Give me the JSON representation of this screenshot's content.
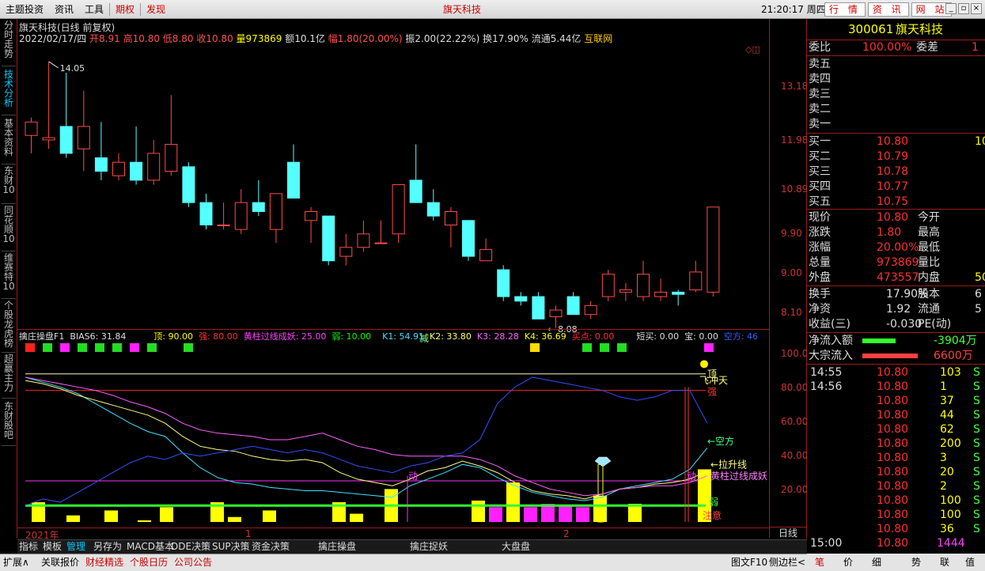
{
  "menu": {
    "items": [
      "主题投资",
      "资讯",
      "工具"
    ],
    "red_items": [
      "期权",
      "发现"
    ],
    "title": "旗天科技",
    "clock": "21:20:17 周四",
    "nav": [
      "行 情",
      "资 讯",
      "网 站"
    ]
  },
  "left_tabs": [
    "分时走势",
    "技术分析",
    "基本资料",
    "东财10",
    "同花顺10",
    "维赛特10",
    "个股龙虎榜",
    "超赢主力",
    "东财股吧"
  ],
  "header": {
    "line1": "旗天科技(日线 前复权)",
    "date": "2022/02/17/四",
    "open": "开8.91",
    "high": "高10.80",
    "low": "低8.80",
    "close": "收10.80",
    "vol": "量973869",
    "amt": "额10.1亿",
    "chg": "幅1.80(20.00%)",
    "amp": "振2.00(22.22%)",
    "turn": "换17.90%",
    "float": "流通5.44亿",
    "concept": "互联网"
  },
  "price_axis": [
    "13.18",
    "11.98",
    "10.89",
    "9.90",
    "9.00",
    "8.10"
  ],
  "price_annotations": {
    "high": "14.05",
    "low": "8.08",
    "mark": "减"
  },
  "chart_data": {
    "type": "candlestick",
    "ylim": [
      7.9,
      14.4
    ],
    "candles": [
      {
        "o": 12.4,
        "h": 12.8,
        "l": 12.0,
        "c": 12.7
      },
      {
        "o": 12.3,
        "h": 14.05,
        "l": 12.1,
        "c": 12.35
      },
      {
        "o": 12.6,
        "h": 13.8,
        "l": 11.9,
        "c": 12.0
      },
      {
        "o": 12.1,
        "h": 13.4,
        "l": 11.6,
        "c": 12.6
      },
      {
        "o": 11.9,
        "h": 12.7,
        "l": 11.4,
        "c": 11.6
      },
      {
        "o": 11.5,
        "h": 12.0,
        "l": 11.4,
        "c": 11.8
      },
      {
        "o": 11.8,
        "h": 12.6,
        "l": 11.3,
        "c": 11.4
      },
      {
        "o": 11.4,
        "h": 12.3,
        "l": 11.3,
        "c": 12.0
      },
      {
        "o": 11.6,
        "h": 13.3,
        "l": 11.5,
        "c": 12.2
      },
      {
        "o": 11.7,
        "h": 11.8,
        "l": 10.8,
        "c": 10.9
      },
      {
        "o": 10.9,
        "h": 11.1,
        "l": 10.3,
        "c": 10.4
      },
      {
        "o": 10.4,
        "h": 10.9,
        "l": 10.3,
        "c": 10.4
      },
      {
        "o": 10.3,
        "h": 11.2,
        "l": 10.2,
        "c": 10.9
      },
      {
        "o": 10.9,
        "h": 11.4,
        "l": 10.6,
        "c": 10.7
      },
      {
        "o": 10.3,
        "h": 11.1,
        "l": 10.0,
        "c": 11.1
      },
      {
        "o": 11.8,
        "h": 12.2,
        "l": 11.0,
        "c": 11.0
      },
      {
        "o": 10.5,
        "h": 10.8,
        "l": 10.0,
        "c": 10.7
      },
      {
        "o": 10.6,
        "h": 10.6,
        "l": 9.5,
        "c": 9.6
      },
      {
        "o": 9.7,
        "h": 10.2,
        "l": 9.5,
        "c": 9.9
      },
      {
        "o": 9.9,
        "h": 10.5,
        "l": 9.8,
        "c": 10.2
      },
      {
        "o": 10.0,
        "h": 10.5,
        "l": 10.0,
        "c": 10.0
      },
      {
        "o": 10.2,
        "h": 11.3,
        "l": 10.0,
        "c": 11.3
      },
      {
        "o": 11.4,
        "h": 12.2,
        "l": 10.9,
        "c": 10.9
      },
      {
        "o": 10.9,
        "h": 11.2,
        "l": 10.5,
        "c": 10.6
      },
      {
        "o": 10.4,
        "h": 10.8,
        "l": 9.9,
        "c": 10.7
      },
      {
        "o": 10.5,
        "h": 10.5,
        "l": 9.6,
        "c": 9.7
      },
      {
        "o": 9.6,
        "h": 10.1,
        "l": 9.6,
        "c": 9.85
      },
      {
        "o": 9.4,
        "h": 9.5,
        "l": 8.7,
        "c": 8.8
      },
      {
        "o": 8.8,
        "h": 8.9,
        "l": 8.6,
        "c": 8.7
      },
      {
        "o": 8.8,
        "h": 8.9,
        "l": 8.3,
        "c": 8.3
      },
      {
        "o": 8.35,
        "h": 8.6,
        "l": 8.1,
        "c": 8.5
      },
      {
        "o": 8.8,
        "h": 8.9,
        "l": 8.4,
        "c": 8.4
      },
      {
        "o": 8.4,
        "h": 8.7,
        "l": 8.3,
        "c": 8.6
      },
      {
        "o": 8.8,
        "h": 9.4,
        "l": 8.7,
        "c": 9.3
      },
      {
        "o": 8.9,
        "h": 9.1,
        "l": 8.7,
        "c": 8.95
      },
      {
        "o": 8.8,
        "h": 9.6,
        "l": 8.7,
        "c": 9.3
      },
      {
        "o": 8.8,
        "h": 9.2,
        "l": 8.7,
        "c": 8.9
      },
      {
        "o": 8.9,
        "h": 8.95,
        "l": 8.6,
        "c": 8.85
      },
      {
        "o": 8.95,
        "h": 9.6,
        "l": 8.9,
        "c": 9.35
      },
      {
        "o": 8.9,
        "h": 10.8,
        "l": 8.8,
        "c": 10.8
      }
    ]
  },
  "indicator": {
    "name": "擒庄操盘F1",
    "bias": "BIAS6: 31.84",
    "top": "顶: 90.00",
    "strong": "强: 80.00",
    "yellow": "黄柱过线成妖: 25.00",
    "weak": "弱: 10.00",
    "k1": "K1: 54.91",
    "k2": "K2: 33.80",
    "k3": "K3: 28.28",
    "k4": "K4: 36.69",
    "buy": "买点: 0.00",
    "short": "短买: 0.00",
    "bao": "宝: 0.00",
    "kong": "空方: 46",
    "axis": [
      "100.0",
      "80.00",
      "60.00",
      "40.00",
      "20.00"
    ],
    "labels": {
      "ding": "顶",
      "feichongtian": "飞冲天",
      "qiang": "强",
      "kongfang": "←空方",
      "lashengxian": "←拉升线",
      "huangzhu": "黄柱过线成妖",
      "ruo": "弱",
      "zhuyi": "注意",
      "dong1": "动",
      "dong2": "动"
    }
  },
  "time_axis": {
    "year": "2021年",
    "m1": "1",
    "m2": "2",
    "period": "日线"
  },
  "bottom_tabs": [
    "指标",
    "模板",
    "管理",
    "另存为",
    "MACD基本",
    "DDE决策",
    "SUP决策",
    "资金决策",
    "擒庄操盘",
    "擒庄捉妖",
    "大盘盘"
  ],
  "status_bar": [
    "扩展∧",
    "关联报价",
    "财经精选",
    "个股日历",
    "公司公告"
  ],
  "status_right": [
    "图文F10",
    "侧边栏<"
  ],
  "quote": {
    "code": "300061",
    "name": "旗天科技",
    "weibi_label": "委比",
    "weibi": "100.00%",
    "weicha_label": "委差",
    "weicha": "1",
    "sells": [
      "卖五",
      "卖四",
      "卖三",
      "卖二",
      "卖一"
    ],
    "buys": [
      {
        "l": "买一",
        "p": "10.80",
        "v": "10"
      },
      {
        "l": "买二",
        "p": "10.79",
        "v": ""
      },
      {
        "l": "买三",
        "p": "10.78",
        "v": ""
      },
      {
        "l": "买四",
        "p": "10.77",
        "v": ""
      },
      {
        "l": "买五",
        "p": "10.75",
        "v": ""
      }
    ],
    "stats": [
      {
        "l": "现价",
        "v": "10.80",
        "l2": "今开",
        "v2": ""
      },
      {
        "l": "涨跌",
        "v": "1.80",
        "l2": "最高",
        "v2": ""
      },
      {
        "l": "涨幅",
        "v": "20.00%",
        "l2": "最低",
        "v2": ""
      },
      {
        "l": "总量",
        "v": "973869",
        "l2": "量比",
        "v2": ""
      },
      {
        "l": "外盘",
        "v": "473557",
        "l2": "内盘",
        "v2": "50"
      }
    ],
    "stats2": [
      {
        "l": "换手",
        "v": "17.90%",
        "l2": "股本",
        "v2": "6"
      },
      {
        "l": "净资",
        "v": "1.92",
        "l2": "流通",
        "v2": "5"
      },
      {
        "l": "收益(三)",
        "v": "-0.030",
        "l2": "PE(动)",
        "v2": ""
      }
    ],
    "flow": [
      {
        "l": "净流入额",
        "v": "-3904万"
      },
      {
        "l": "大宗流入",
        "v": "6600万"
      }
    ],
    "ticks": [
      {
        "t": "14:55",
        "p": "10.80",
        "v": "103",
        "s": "S"
      },
      {
        "t": "14:56",
        "p": "10.80",
        "v": "1",
        "s": "S"
      },
      {
        "t": "",
        "p": "10.80",
        "v": "37",
        "s": "S"
      },
      {
        "t": "",
        "p": "10.80",
        "v": "44",
        "s": "S"
      },
      {
        "t": "",
        "p": "10.80",
        "v": "62",
        "s": "S"
      },
      {
        "t": "",
        "p": "10.80",
        "v": "200",
        "s": "S"
      },
      {
        "t": "",
        "p": "10.80",
        "v": "3",
        "s": "S"
      },
      {
        "t": "",
        "p": "10.80",
        "v": "20",
        "s": "S"
      },
      {
        "t": "",
        "p": "10.80",
        "v": "2",
        "s": "S"
      },
      {
        "t": "",
        "p": "10.80",
        "v": "100",
        "s": "S"
      },
      {
        "t": "",
        "p": "10.80",
        "v": "100",
        "s": "S"
      },
      {
        "t": "",
        "p": "10.80",
        "v": "36",
        "s": "S"
      },
      {
        "t": "15:00",
        "p": "10.80",
        "v": "1444",
        "s": ""
      }
    ],
    "bottom_tabs": [
      "笔",
      "价",
      "细",
      "势",
      "联",
      "值"
    ]
  }
}
